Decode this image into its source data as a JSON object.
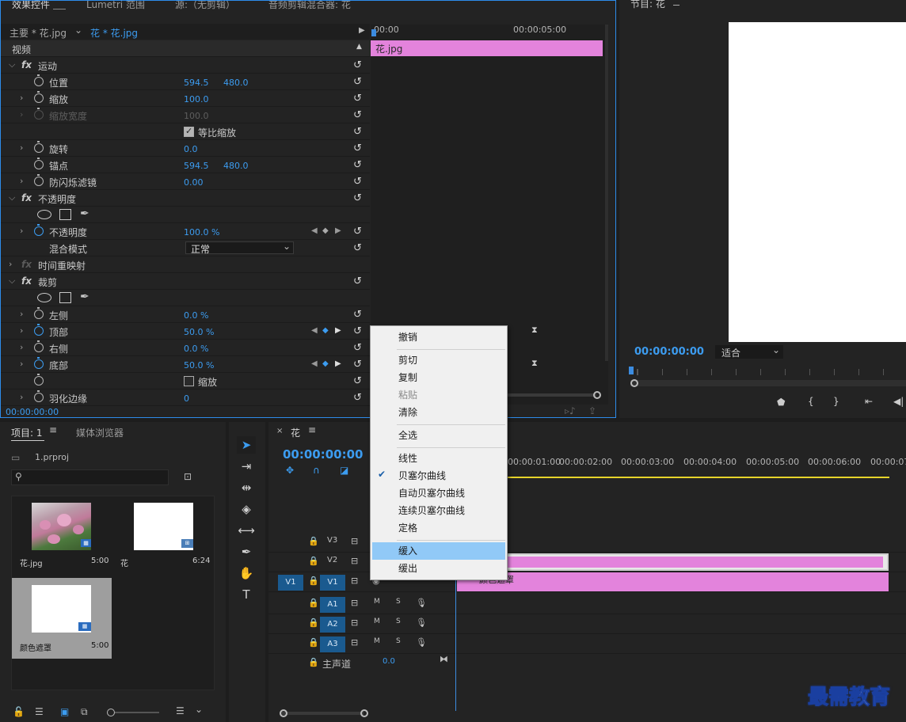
{
  "effect_controls": {
    "tabs": [
      "效果控件",
      "Lumetri 范围",
      "源:（无剪辑）",
      "音频剪辑混合器: 花"
    ],
    "clip_selector": {
      "master": "主要 * 花.jpg",
      "sequence": "花 * 花.jpg"
    },
    "section_video": "视频",
    "timeline_ruler": {
      "start": "00:00",
      "mark": "00:00:05:00"
    },
    "clip_label": "花.jpg",
    "motion": {
      "name": "运动",
      "position": {
        "label": "位置",
        "x": "594.5",
        "y": "480.0"
      },
      "scale": {
        "label": "缩放",
        "value": "100.0"
      },
      "scale_width": {
        "label": "缩放宽度",
        "value": "100.0"
      },
      "uniform_scale": {
        "label": "等比缩放"
      },
      "rotation": {
        "label": "旋转",
        "value": "0.0"
      },
      "anchor": {
        "label": "锚点",
        "x": "594.5",
        "y": "480.0"
      },
      "flicker": {
        "label": "防闪烁滤镜",
        "value": "0.00"
      }
    },
    "opacity": {
      "name": "不透明度",
      "value_label": "不透明度",
      "value": "100.0 %",
      "blend_label": "混合模式",
      "blend_value": "正常"
    },
    "time_remap": {
      "name": "时间重映射"
    },
    "crop": {
      "name": "裁剪",
      "left": {
        "label": "左侧",
        "value": "0.0 %"
      },
      "top": {
        "label": "顶部",
        "value": "50.0 %"
      },
      "right": {
        "label": "右侧",
        "value": "0.0 %"
      },
      "bottom": {
        "label": "底部",
        "value": "50.0 %"
      },
      "zoom": {
        "label": "缩放"
      },
      "feather": {
        "label": "羽化边缘",
        "value": "0"
      }
    },
    "timecode": "00:00:00:00"
  },
  "program": {
    "title": "节目: 花",
    "timecode": "00:00:00:00",
    "fit": "适合"
  },
  "project": {
    "tab_project": "项目: 1",
    "tab_media": "媒体浏览器",
    "file": "1.prproj",
    "items": [
      {
        "name": "花.jpg",
        "duration": "5:00"
      },
      {
        "name": "花",
        "duration": "6:24"
      },
      {
        "name": "颜色遮罩",
        "duration": "5:00"
      }
    ]
  },
  "timeline": {
    "tab": "花",
    "timecode": "00:00:00:00",
    "ruler": [
      "00:00:01:00",
      "00:00:02:00",
      "00:00:03:00",
      "00:00:04:00",
      "00:00:05:00",
      "00:00:06:00",
      "00:00:07:"
    ],
    "tracks": {
      "v3": "V3",
      "v2": "V2",
      "v1": "V1",
      "v1_src": "V1",
      "a1": "A1",
      "a2": "A2",
      "a3": "A3",
      "m": "M",
      "s": "S",
      "master": "主声道",
      "master_value": "0.0"
    },
    "clip_v1": "颜色遮罩"
  },
  "context_menu": {
    "undo": "撤销",
    "cut": "剪切",
    "copy": "复制",
    "paste": "粘贴",
    "clear": "清除",
    "select_all": "全选",
    "linear": "线性",
    "bezier": "贝塞尔曲线",
    "auto_bezier": "自动贝塞尔曲线",
    "continuous_bezier": "连续贝塞尔曲线",
    "hold": "定格",
    "ease_in": "缓入",
    "ease_out": "缓出"
  },
  "watermark": "最需教育"
}
